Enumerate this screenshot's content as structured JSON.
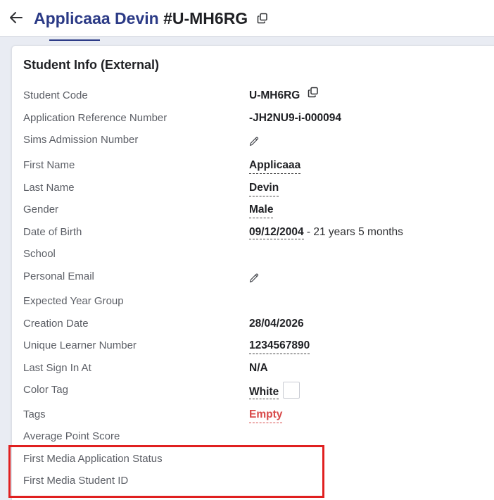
{
  "header": {
    "title_name": "Applicaaa Devin",
    "title_code": "#U-MH6RG"
  },
  "card": {
    "title": "Student Info (External)"
  },
  "fields": {
    "student_code": {
      "label": "Student Code",
      "value": "U-MH6RG"
    },
    "app_ref": {
      "label": "Application Reference Number",
      "value": "-JH2NU9-i-000094"
    },
    "sims": {
      "label": "Sims Admission Number"
    },
    "first_name": {
      "label": "First Name",
      "value": "Applicaaa"
    },
    "last_name": {
      "label": "Last Name",
      "value": "Devin"
    },
    "gender": {
      "label": "Gender",
      "value": "Male"
    },
    "dob": {
      "label": "Date of Birth",
      "value": "09/12/2004",
      "suffix": " - 21 years 5 months"
    },
    "school": {
      "label": "School"
    },
    "personal_email": {
      "label": "Personal Email"
    },
    "expected_year_group": {
      "label": "Expected Year Group"
    },
    "creation_date": {
      "label": "Creation Date",
      "value": "28/04/2026"
    },
    "uln": {
      "label": "Unique Learner Number",
      "value": "1234567890"
    },
    "last_sign_in": {
      "label": "Last Sign In At",
      "value": "N/A"
    },
    "color_tag": {
      "label": "Color Tag",
      "value": "White",
      "swatch_color": "#ffffff"
    },
    "tags": {
      "label": "Tags",
      "value": "Empty"
    },
    "avg_point_score": {
      "label": "Average Point Score"
    },
    "fm_app_status": {
      "label": "First Media Application Status"
    },
    "fm_student_id": {
      "label": "First Media Student ID"
    }
  },
  "colors": {
    "brand_title": "#2b3a86",
    "empty_red": "#d84a4a",
    "highlight_red": "#e02020"
  },
  "icons": [
    "arrow-left-icon",
    "copy-icon",
    "pencil-icon"
  ]
}
